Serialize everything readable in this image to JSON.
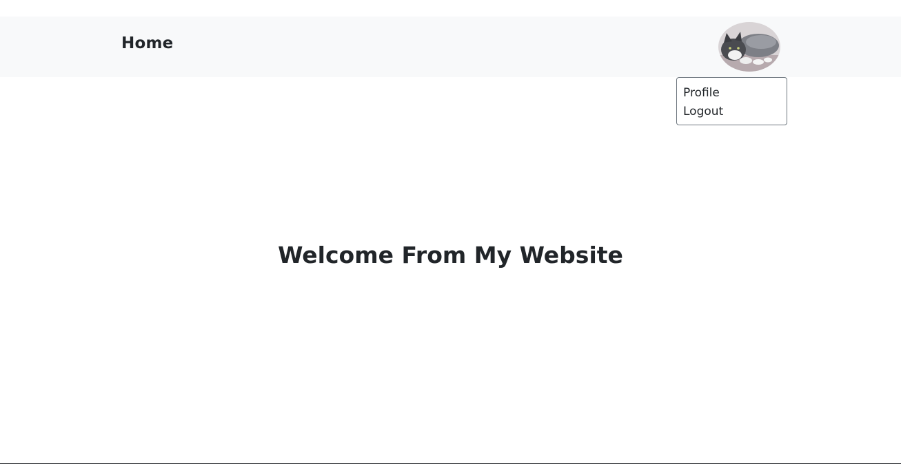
{
  "navbar": {
    "brand_label": "Home",
    "background": "#f8f9fa",
    "avatar_icon": "cat-avatar-photo"
  },
  "dropdown": {
    "items": [
      {
        "label": "Profile"
      },
      {
        "label": "Logout"
      }
    ]
  },
  "main": {
    "title": "Welcome From My Website"
  }
}
